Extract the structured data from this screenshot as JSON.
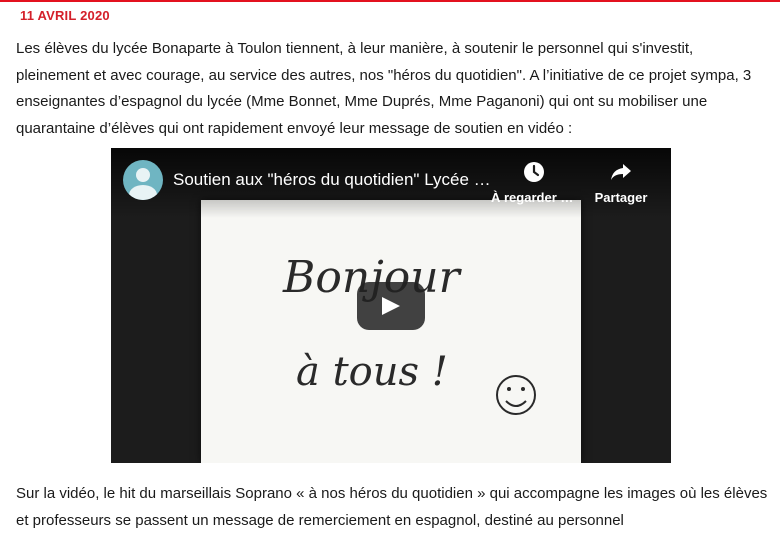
{
  "article": {
    "date": "11 AVRIL 2020",
    "intro": "Les élèves du lycée Bonaparte à Toulon tiennent, à leur manière, à soutenir le personnel qui s'investit, pleinement et avec courage, au service des autres, nos \"héros du quotidien\". A l’initiative de ce projet sympa, 3 enseignantes d’espagnol du lycée (Mme Bonnet, Mme Duprés, Mme Paganoni) qui ont su mobiliser une quarantaine d’élèves qui ont rapidement envoyé leur message de soutien en vidéo :",
    "outro": "Sur la vidéo, le hit du marseillais Soprano « à nos héros du quotidien » qui accompagne les images où les élèves et professeurs se passent un message de remerciement en espagnol, destiné au personnel"
  },
  "video": {
    "title": "Soutien aux \"héros du quotidien\" Lycée Bonaparte Toulon",
    "watch_later_label": "À regarder plus tard",
    "share_label": "Partager",
    "thumbnail_text_line1": "Bonjour",
    "thumbnail_text_line2": "à tous !",
    "channel_icon": "avatar-icon",
    "accent_color": "#d4202a"
  }
}
